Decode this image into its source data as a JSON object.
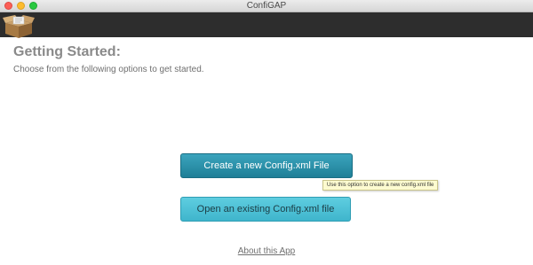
{
  "window": {
    "title": "ConfiGAP"
  },
  "toolbar": {
    "logo_icon": "open-box-icon"
  },
  "main": {
    "heading": "Getting Started:",
    "subheading": "Choose from the following options to get started.",
    "create_button_label": "Create a new Config.xml File",
    "open_button_label": "Open an existing Config.xml file",
    "tooltip_text": "Use this option to create a new config.xml file",
    "about_link": "About this App"
  },
  "colors": {
    "toolbar_bg": "#2d2d2d",
    "primary_button": "#2a92ab",
    "secondary_button": "#4ec2d8",
    "heading_text": "#8a8a8a"
  }
}
